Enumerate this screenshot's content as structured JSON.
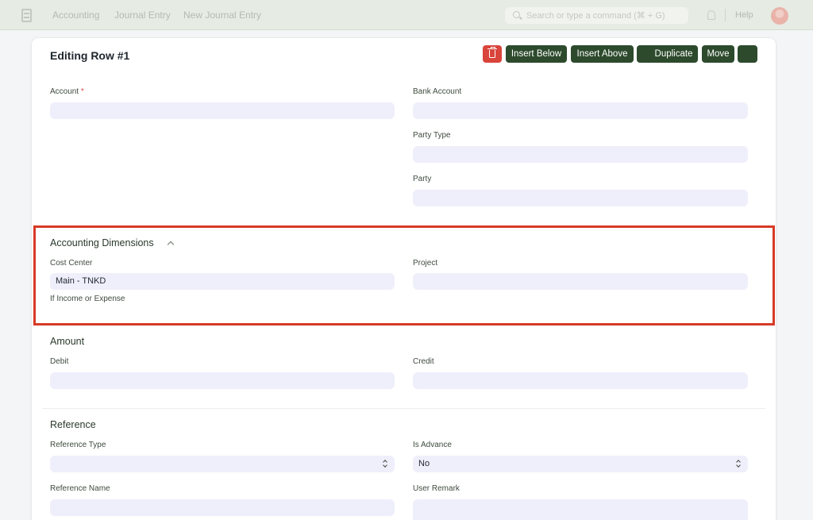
{
  "navbar": {
    "breadcrumbs": [
      "Accounting",
      "Journal Entry",
      "New Journal Entry"
    ],
    "search_placeholder": "Search or type a command (⌘ + G)",
    "help_label": "Help",
    "icons": [
      "app-logo-icon",
      "search-icon",
      "bell-icon",
      "avatar"
    ]
  },
  "dialog": {
    "title": "Editing Row #1",
    "actions": {
      "insert_below": "Insert Below",
      "insert_above": "Insert Above",
      "duplicate": "Duplicate",
      "move": "Move"
    }
  },
  "details": {
    "account_label": "Account",
    "account_required_mark": "*",
    "bank_account_label": "Bank Account",
    "party_type_label": "Party Type",
    "party_label": "Party"
  },
  "dimensions": {
    "title": "Accounting Dimensions",
    "cost_center_label": "Cost Center",
    "cost_center_value": "Main - TNKD",
    "cost_center_hint": "If Income or Expense",
    "project_label": "Project"
  },
  "amount": {
    "title": "Amount",
    "debit_label": "Debit",
    "credit_label": "Credit"
  },
  "reference": {
    "title": "Reference",
    "reference_type_label": "Reference Type",
    "is_advance_label": "Is Advance",
    "is_advance_value": "No",
    "reference_name_label": "Reference Name",
    "user_remark_label": "User Remark"
  },
  "colors": {
    "primary_button": "#2d4a2d",
    "danger_button": "#d9443b",
    "field_bg": "#efeefb",
    "highlight": "#d73a26"
  }
}
